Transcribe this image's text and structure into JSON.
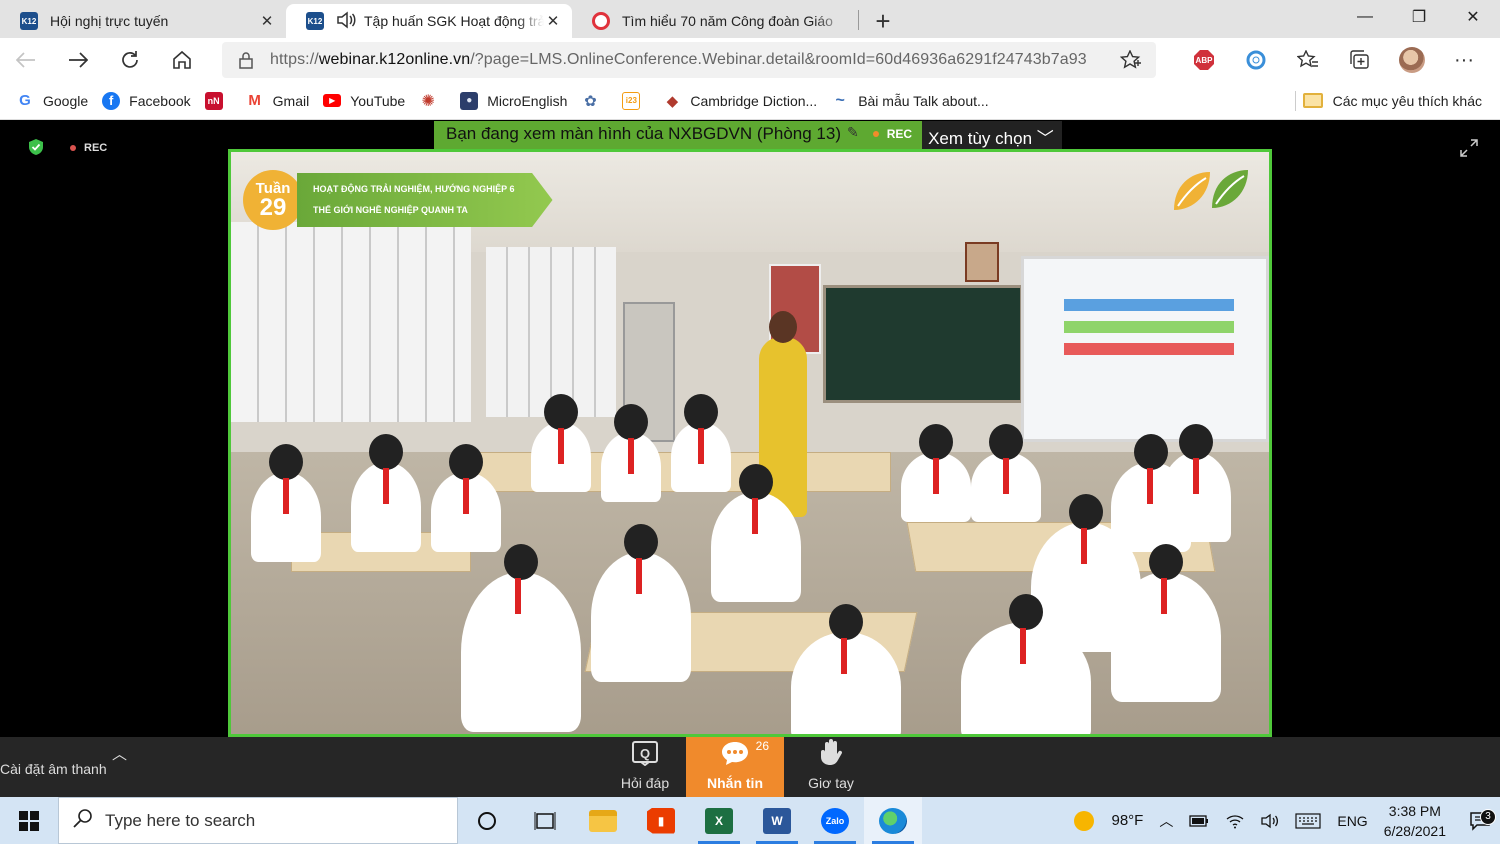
{
  "tabs": [
    {
      "icon": "k12-logo-icon",
      "icon_text": "K12",
      "title": "Hội nghị trực tuyến",
      "active": false
    },
    {
      "icon": "k12-logo-icon",
      "icon_text": "K12",
      "title": "Tập huấn SGK Hoạt động trải",
      "active": true,
      "audio": true
    },
    {
      "icon": "red-swirl-icon",
      "icon_text": "",
      "title": "Tìm hiểu 70 năm Công đoàn Giáo",
      "active": false
    }
  ],
  "address": {
    "url_prefix": "https://",
    "url_domain": "webinar.k12online.vn",
    "url_rest": "/?page=LMS.OnlineConference.Webinar.detail&roomId=60d46936a6291f24743b7a93"
  },
  "bookmarks": [
    {
      "label": "Google",
      "icon": "google-icon",
      "icon_text": "G",
      "color": "#4285f4"
    },
    {
      "label": "Facebook",
      "icon": "facebook-icon",
      "icon_text": "f",
      "color": "#1877f2"
    },
    {
      "label": "",
      "icon": "nn-icon",
      "icon_text": "nN",
      "color": "#c8102e"
    },
    {
      "label": "Gmail",
      "icon": "gmail-icon",
      "icon_text": "M",
      "color": "#ea4335"
    },
    {
      "label": "YouTube",
      "icon": "youtube-icon",
      "icon_text": "▶",
      "color": "#ff0000"
    },
    {
      "label": "",
      "icon": "globe-red-icon",
      "icon_text": "✺",
      "color": "#c0392b"
    },
    {
      "label": "MicroEnglish",
      "icon": "microenglish-icon",
      "icon_text": "●",
      "color": "#2c3e6b"
    },
    {
      "label": "",
      "icon": "puzzle-icon",
      "icon_text": "✿",
      "color": "#4a6fa5"
    },
    {
      "label": "",
      "icon": "i23-icon",
      "icon_text": "i23",
      "color": "#f39c12"
    },
    {
      "label": "Cambridge Diction...",
      "icon": "cambridge-icon",
      "icon_text": "◆",
      "color": "#b03a2e"
    },
    {
      "label": "Bài mẫu Talk about...",
      "icon": "bird-icon",
      "icon_text": "~",
      "color": "#3b6fb6"
    }
  ],
  "bookmarks_other": "Các mục yêu thích khác",
  "webinar": {
    "rec_label": "REC",
    "share_text": "Bạn đang xem màn hình của NXBGDVN (Phòng 13)",
    "share_rec": "REC",
    "view_options": "Xem tùy chọn",
    "video_week_label": "Tuần",
    "video_week_number": "29",
    "video_line1": "HOẠT ĐỘNG TRẢI NGHIỆM, HƯỚNG NGHIỆP 6",
    "video_line2": "THẾ GIỚI NGHỀ NGHIỆP QUANH TA"
  },
  "controls": {
    "audio_settings": "Cài đặt âm thanh",
    "qa": "Hỏi đáp",
    "chat": "Nhắn tin",
    "chat_count": "26",
    "raise_hand": "Giơ tay"
  },
  "taskbar": {
    "search_placeholder": "Type here to search",
    "weather": "98°F",
    "language": "ENG",
    "time": "3:38 PM",
    "date": "6/28/2021",
    "notifications": "3"
  },
  "colors": {
    "accent_green": "#4fc83a",
    "banner_green": "#5ea931",
    "chat_orange": "#f08a2c"
  }
}
